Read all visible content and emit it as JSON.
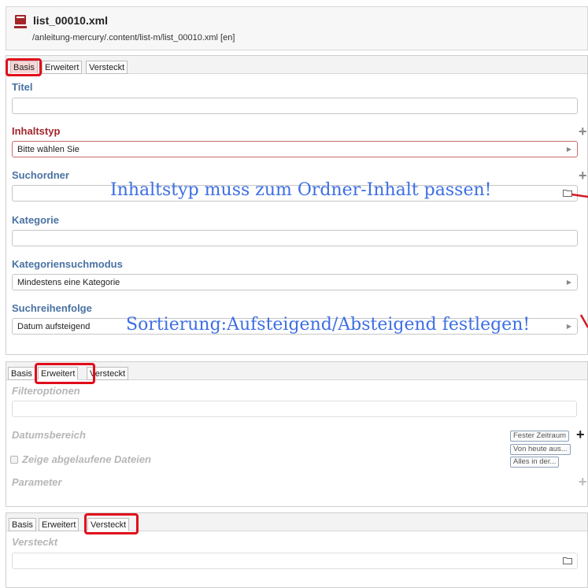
{
  "header": {
    "file_name": "list_00010.xml",
    "file_path": "/anleitung-mercury/.content/list-m/list_00010.xml [en]"
  },
  "tabs": {
    "basis": "Basis",
    "erweitert": "Erweitert",
    "versteckt": "Versteckt"
  },
  "basis_panel": {
    "titel_label": "Titel",
    "titel_value": "",
    "inhaltstyp_label": "Inhaltstyp",
    "inhaltstyp_value": "Bitte wählen Sie",
    "suchordner_label": "Suchordner",
    "suchordner_value": "",
    "kategorie_label": "Kategorie",
    "kategorie_value": "",
    "kategoriensuchmodus_label": "Kategoriensuchmodus",
    "kategoriensuchmodus_value": "Mindestens eine Kategorie",
    "suchreihenfolge_label": "Suchreihenfolge",
    "suchreihenfolge_value": "Datum aufsteigend"
  },
  "erweitert_panel": {
    "filteroptionen_label": "Filteroptionen",
    "filteroptionen_value": "",
    "datumsbereich_label": "Datumsbereich",
    "zeige_abgelaufene_label": "Zeige abgelaufene Dateien",
    "parameter_label": "Parameter",
    "date_options": [
      "Fester Zeitraum",
      "Von heute aus...",
      "Alles in der..."
    ]
  },
  "versteckt_panel": {
    "versteckt_label": "Versteckt",
    "versteckt_value": ""
  },
  "annotations": {
    "inhaltstyp_note": "Inhaltstyp muss zum Ordner-Inhalt passen!",
    "sortierung_note": "Sortierung:Aufsteigend/Absteigend festlegen!"
  },
  "colors": {
    "field_label_blue": "#4a72a3",
    "required_label_red": "#a3262a",
    "annotation_blue": "#3d6fe3",
    "highlight_red": "#e20d1b"
  },
  "icons": {
    "file": "file-icon",
    "folder": "folder-icon",
    "add": "plus-icon",
    "dropdown": "chevron-right-icon"
  }
}
